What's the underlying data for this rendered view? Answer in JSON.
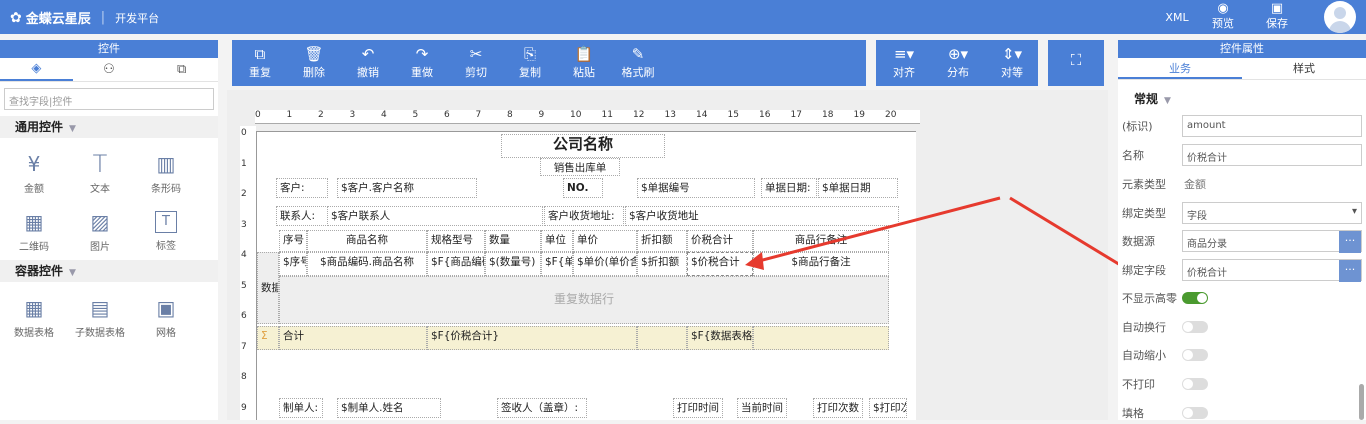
{
  "topbar": {
    "brand": "金蝶云星辰",
    "separator": "|",
    "platform": "开发平台",
    "xml": "XML",
    "preview": "预览",
    "save": "保存"
  },
  "left": {
    "title": "控件",
    "search_placeholder": "查找字段|控件",
    "section_common": "通用控件",
    "section_container": "容器控件",
    "common": [
      {
        "label": "金额",
        "icon": "¥"
      },
      {
        "label": "文本",
        "icon": "T"
      },
      {
        "label": "条形码",
        "icon": "▥"
      },
      {
        "label": "二维码",
        "icon": "▦"
      },
      {
        "label": "图片",
        "icon": "▨"
      },
      {
        "label": "标签",
        "icon": "T"
      }
    ],
    "container": [
      {
        "label": "数据表格",
        "icon": "▦"
      },
      {
        "label": "子数据表格",
        "icon": "▤"
      },
      {
        "label": "网格",
        "icon": "▣"
      }
    ]
  },
  "toolbar": {
    "left": [
      "重复",
      "删除",
      "撤销",
      "重做",
      "剪切",
      "复制",
      "粘贴",
      "格式刷"
    ],
    "right": [
      "对齐",
      "分布",
      "对等"
    ]
  },
  "ruler": {
    "h": [
      "0",
      "1",
      "2",
      "3",
      "4",
      "5",
      "6",
      "7",
      "8",
      "9",
      "10",
      "11",
      "12",
      "13",
      "14",
      "15",
      "16",
      "17",
      "18",
      "19",
      "20"
    ],
    "v": [
      "0",
      "1",
      "2",
      "3",
      "4",
      "5",
      "6",
      "7",
      "8",
      "9"
    ]
  },
  "doc": {
    "company": "公司名称",
    "subtitle": "销售出库单",
    "customer_lbl": "客户:",
    "customer_val": "$客户.客户名称",
    "no_lbl": "NO.",
    "no_val": "$单据编号",
    "date_lbl": "单据日期:",
    "date_val": "$单据日期",
    "contact_lbl": "联系人:",
    "contact_val": "$客户联系人",
    "addr_lbl": "客户收货地址:",
    "addr_val": "$客户收货地址",
    "headers": [
      "序号",
      "商品名称",
      "规格型号",
      "数量",
      "单位",
      "单价",
      "折扣额",
      "价税合计",
      "商品行备注"
    ],
    "row": [
      "$序号",
      "$商品编码.商品名称",
      "$F{商品编码",
      "$(数量号)",
      "$F{单位",
      "$单价(单价含税)",
      "$折扣额",
      "$价税合计",
      "$商品行备注"
    ],
    "side": "数据",
    "repeat": "重复数据行",
    "sum_label": "合计",
    "sum_val": "$F{价税合计}",
    "sum_val2": "$F{数据表格",
    "maker_lbl": "制单人:",
    "maker_val": "$制单人.姓名",
    "signer_lbl": "签收人（盖章）:",
    "print_time": "打印时间",
    "cur_time": "当前时间",
    "print_count": "打印次数",
    "print_extra": "$打印次"
  },
  "right": {
    "title": "控件属性",
    "tab_biz": "业务",
    "tab_style": "样式",
    "group": "常规",
    "props": [
      {
        "label": "(标识)",
        "value": "amount"
      },
      {
        "label": "名称",
        "value": "价税合计"
      },
      {
        "label": "元素类型",
        "value": "金额"
      },
      {
        "label": "绑定类型",
        "value": "字段"
      },
      {
        "label": "数据源",
        "value": "商品分录"
      },
      {
        "label": "绑定字段",
        "value": "价税合计"
      }
    ],
    "toggles": [
      {
        "label": "不显示高零",
        "on": true
      },
      {
        "label": "自动换行",
        "on": false
      },
      {
        "label": "自动缩小",
        "on": false
      },
      {
        "label": "不打印",
        "on": false
      },
      {
        "label": "填格",
        "on": false
      }
    ],
    "more": "···",
    "dropdown": "▾"
  },
  "colors": {
    "brand": "#4a7fd6",
    "arrow": "#e63a2e",
    "toggle_on": "#4a9a2f"
  }
}
